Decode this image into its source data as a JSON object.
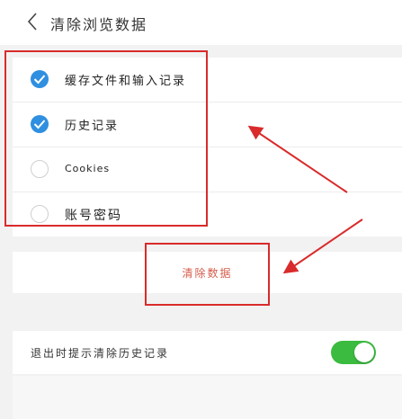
{
  "header": {
    "title": "清除浏览数据",
    "back_icon": "chevron-left-icon"
  },
  "options": [
    {
      "label": "缓存文件和输入记录",
      "checked": true
    },
    {
      "label": "历史记录",
      "checked": true
    },
    {
      "label": "Cookies",
      "checked": false
    },
    {
      "label": "账号密码",
      "checked": false
    }
  ],
  "clear_button": {
    "label": "清除数据",
    "color": "#d65b4a"
  },
  "exit_prompt": {
    "label": "退出时提示清除历史记录",
    "enabled": true
  },
  "colors": {
    "accent": "#2f8fe0",
    "toggle_on": "#3bbb3f",
    "annotation": "#d92b2b"
  }
}
